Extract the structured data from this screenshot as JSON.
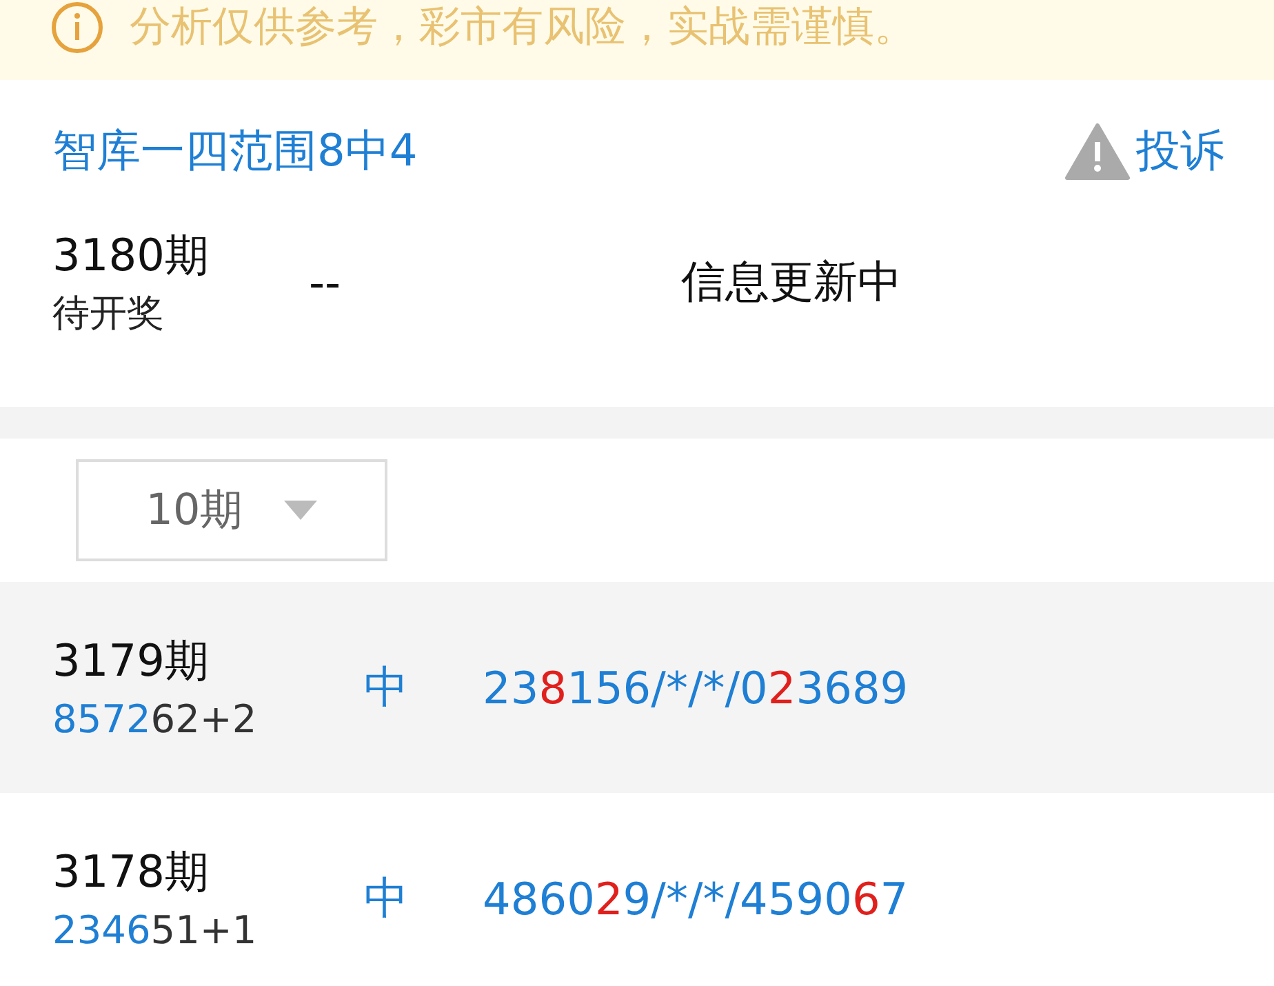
{
  "notice": {
    "text": "分析仅供参考，彩市有风险，实战需谨慎。"
  },
  "header": {
    "title": "智库一四范围8中4",
    "report": "投诉"
  },
  "current": {
    "period": "3180期",
    "status": "待开奖",
    "result": "--",
    "info": "信息更新中"
  },
  "filter": {
    "value": "10期"
  },
  "rows": [
    {
      "period": "3179期",
      "draw": [
        {
          "text": "8572",
          "color": "#1e7fd4"
        },
        {
          "text": "62+2",
          "color": "#333333"
        }
      ],
      "mark": "中",
      "prediction": [
        {
          "text": "23",
          "color": "#1e7fd4"
        },
        {
          "text": "8",
          "color": "#e0201c"
        },
        {
          "text": "156/*/*/0",
          "color": "#1e7fd4"
        },
        {
          "text": "2",
          "color": "#e0201c"
        },
        {
          "text": "3689",
          "color": "#1e7fd4"
        }
      ]
    },
    {
      "period": "3178期",
      "draw": [
        {
          "text": "2346",
          "color": "#1e7fd4"
        },
        {
          "text": "51+1",
          "color": "#333333"
        }
      ],
      "mark": "中",
      "prediction": [
        {
          "text": "4860",
          "color": "#1e7fd4"
        },
        {
          "text": "2",
          "color": "#e0201c"
        },
        {
          "text": "9/*/*/4590",
          "color": "#1e7fd4"
        },
        {
          "text": "6",
          "color": "#e0201c"
        },
        {
          "text": "7",
          "color": "#1e7fd4"
        }
      ]
    }
  ]
}
